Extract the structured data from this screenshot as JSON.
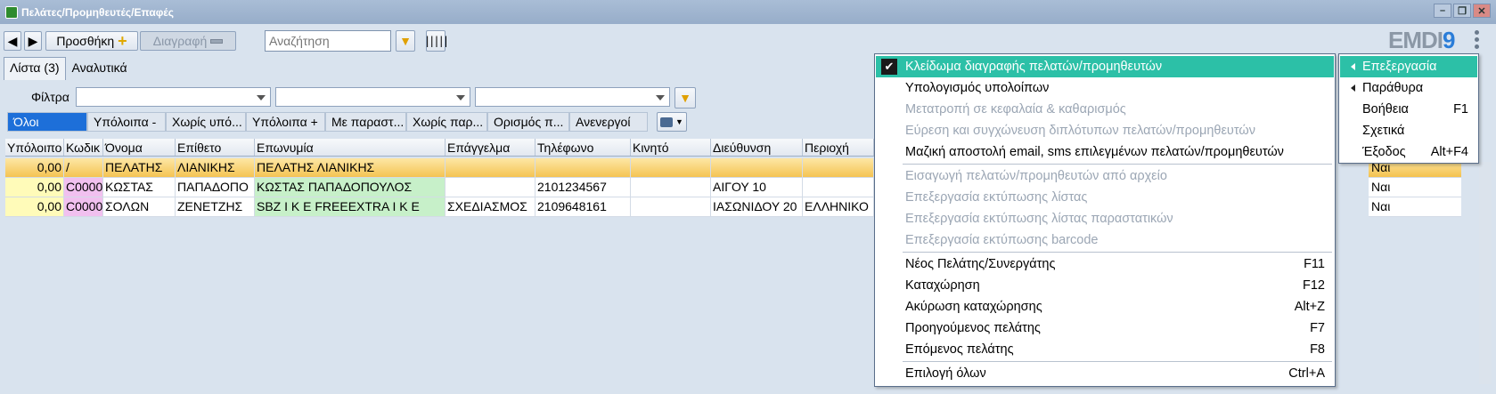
{
  "window": {
    "title": "Πελάτες/Προμηθευτές/Επαφές"
  },
  "toolbar": {
    "add_label": "Προσθήκη",
    "delete_label": "Διαγραφή",
    "search_placeholder": "Αναζήτηση"
  },
  "logo": {
    "text": "EMDI",
    "nine": "9"
  },
  "tabs": [
    {
      "label": "Λίστα (3)"
    },
    {
      "label": "Αναλυτικά"
    }
  ],
  "filters": {
    "label": "Φίλτρα"
  },
  "quick_filters": [
    "Όλοι",
    "Υπόλοιπα -",
    "Χωρίς υπό...",
    "Υπόλοιπα +",
    "Με παραστ...",
    "Χωρίς παρ...",
    "Ορισμός π...",
    "Ανενεργοί"
  ],
  "grid": {
    "columns": [
      "Υπόλοιπο",
      "Κωδικ",
      "Όνομα",
      "Επίθετο",
      "Επωνυμία",
      "Επάγγελμα",
      "Τηλέφωνο",
      "Κινητό",
      "Διεύθυνση",
      "Περιοχή"
    ],
    "rows": [
      {
        "balance": "0,00",
        "code": "/",
        "name": "ΠΕΛΑΤΗΣ",
        "surname": "ΛΙΑΝΙΚΗΣ",
        "company": "ΠΕΛΑΤΗΣ ΛΙΑΝΙΚΗΣ",
        "job": "",
        "phone": "",
        "mobile": "",
        "address": "",
        "area": "",
        "last": "Ναι"
      },
      {
        "balance": "0,00",
        "code": "C0000",
        "name": "ΚΩΣΤΑΣ",
        "surname": "ΠΑΠΑΔΟΠΟ",
        "company": "ΚΩΣΤΑΣ ΠΑΠΑΔΟΠΟΥΛΟΣ",
        "job": "",
        "phone": "2101234567",
        "mobile": "",
        "address": "ΑΙΓΟΥ 10",
        "area": "",
        "last": "Ναι"
      },
      {
        "balance": "0,00",
        "code": "C0000",
        "name": "ΣΟΛΩΝ",
        "surname": "ΖΕΝΕΤΖΗΣ",
        "company": "SBZ I K E  FREEEXTRA I K E",
        "job": "ΣΧΕΔΙΑΣΜΟΣ",
        "phone": "2109648161",
        "mobile": "",
        "address": "ΙΑΣΩΝΙΔΟΥ 20",
        "area": "ΕΛΛΗΝΙΚΟ",
        "last": "Ναι"
      }
    ]
  },
  "context_menu": [
    {
      "label": "Κλείδωμα διαγραφής πελατών/προμηθευτών",
      "shortcut": "",
      "checked": true
    },
    {
      "label": "Υπολογισμός υπολοίπων",
      "shortcut": ""
    },
    {
      "label": "Μετατροπή σε κεφαλαία & καθαρισμός",
      "shortcut": ""
    },
    {
      "label": "Εύρεση και συγχώνευση διπλότυπων πελατών/προμηθευτών",
      "shortcut": ""
    },
    {
      "label": "Μαζική αποστολή email, sms επιλεγμένων πελατών/προμηθευτών",
      "shortcut": ""
    },
    {
      "label": "Εισαγωγή πελατών/προμηθευτών από αρχείο",
      "shortcut": ""
    },
    {
      "label": "Επεξεργασία εκτύπωσης λίστας",
      "shortcut": ""
    },
    {
      "label": "Επεξεργασία εκτύπωσης λίστας παραστατικών",
      "shortcut": ""
    },
    {
      "label": "Επεξεργασία εκτύπωσης barcode",
      "shortcut": ""
    },
    {
      "label": "Νέος Πελάτης/Συνεργάτης",
      "shortcut": "F11"
    },
    {
      "label": "Καταχώρηση",
      "shortcut": "F12"
    },
    {
      "label": "Ακύρωση καταχώρησης",
      "shortcut": "Alt+Z"
    },
    {
      "label": "Προηγούμενος πελάτης",
      "shortcut": "F7"
    },
    {
      "label": "Επόμενος πελάτης",
      "shortcut": "F8"
    },
    {
      "label": "Επιλογή όλων",
      "shortcut": "Ctrl+A"
    }
  ],
  "side_menu": [
    {
      "label": "Επεξεργασία",
      "shortcut": ""
    },
    {
      "label": "Παράθυρα",
      "shortcut": ""
    },
    {
      "label": "Βοήθεια",
      "shortcut": "F1"
    },
    {
      "label": "Σχετικά",
      "shortcut": ""
    },
    {
      "label": "Έξοδος",
      "shortcut": "Alt+F4"
    }
  ],
  "colors": {
    "highlight": "#2cc0a7",
    "selected_row": "#f4c24f",
    "quick_filter_selected": "#1d6fd9"
  }
}
